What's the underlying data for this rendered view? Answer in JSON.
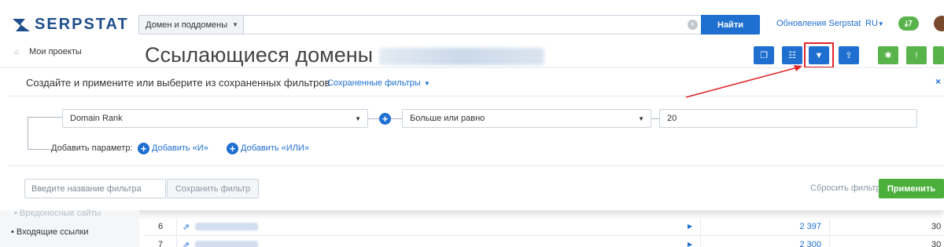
{
  "header": {
    "logo_text": "SERPSTAT",
    "search_type": "Домен и поддомены",
    "search_value": "",
    "search_button": "Найти",
    "updates_link": "Обновления Serpstat",
    "language": "RU",
    "downloads_badge": "7"
  },
  "nav": {
    "my_projects": "Мои проекты",
    "faded_item": "Вредоносные сайты",
    "incoming_links": "Входящие ссылки"
  },
  "page": {
    "title": "Ссылающиеся домены"
  },
  "filter_panel": {
    "title": "Создайте и примените или выберите из сохраненных фильтров",
    "saved_filters": "Сохраненные фильтры",
    "close": "×",
    "parameter": "Domain Rank",
    "operator": "Больше или равно",
    "value": "20",
    "add_param_label": "Добавить параметр:",
    "add_and": "Добавить «И»",
    "add_or": "Добавить «ИЛИ»",
    "name_placeholder": "Введите название фильтра",
    "save_button": "Сохранить фильтр",
    "reset_link": "Сбросить фильтр",
    "apply_button": "Применить"
  },
  "table": {
    "rows": [
      {
        "num": "6",
        "value": "2 397",
        "value2": "30"
      },
      {
        "num": "7",
        "value": "2 300",
        "value2": "30"
      }
    ]
  },
  "colors": {
    "primary": "#1e6fd0",
    "success": "#4caf3c",
    "highlight": "#e0262b",
    "logo": "#1f4e8c"
  }
}
